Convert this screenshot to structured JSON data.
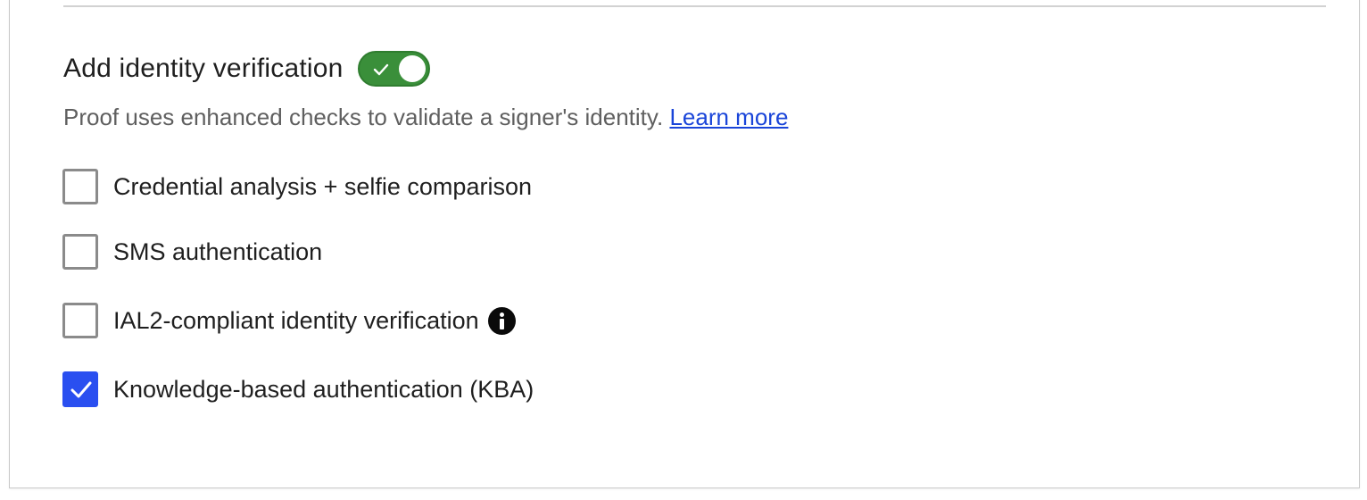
{
  "identity_verification": {
    "heading": "Add identity verification",
    "toggle_on": true,
    "description": "Proof uses enhanced checks to validate a signer's identity.",
    "learn_more": "Learn more",
    "options": [
      {
        "label": "Credential analysis + selfie comparison",
        "checked": false
      },
      {
        "label": "SMS authentication",
        "checked": false
      },
      {
        "label": "IAL2-compliant identity verification",
        "checked": false,
        "icon": "info-icon"
      },
      {
        "label": "Knowledge-based authentication (KBA)",
        "checked": true
      }
    ]
  },
  "colors": {
    "toggle_on": "#3a8f3a",
    "checkbox_checked": "#2a4ff0",
    "link": "#1a45d9"
  }
}
